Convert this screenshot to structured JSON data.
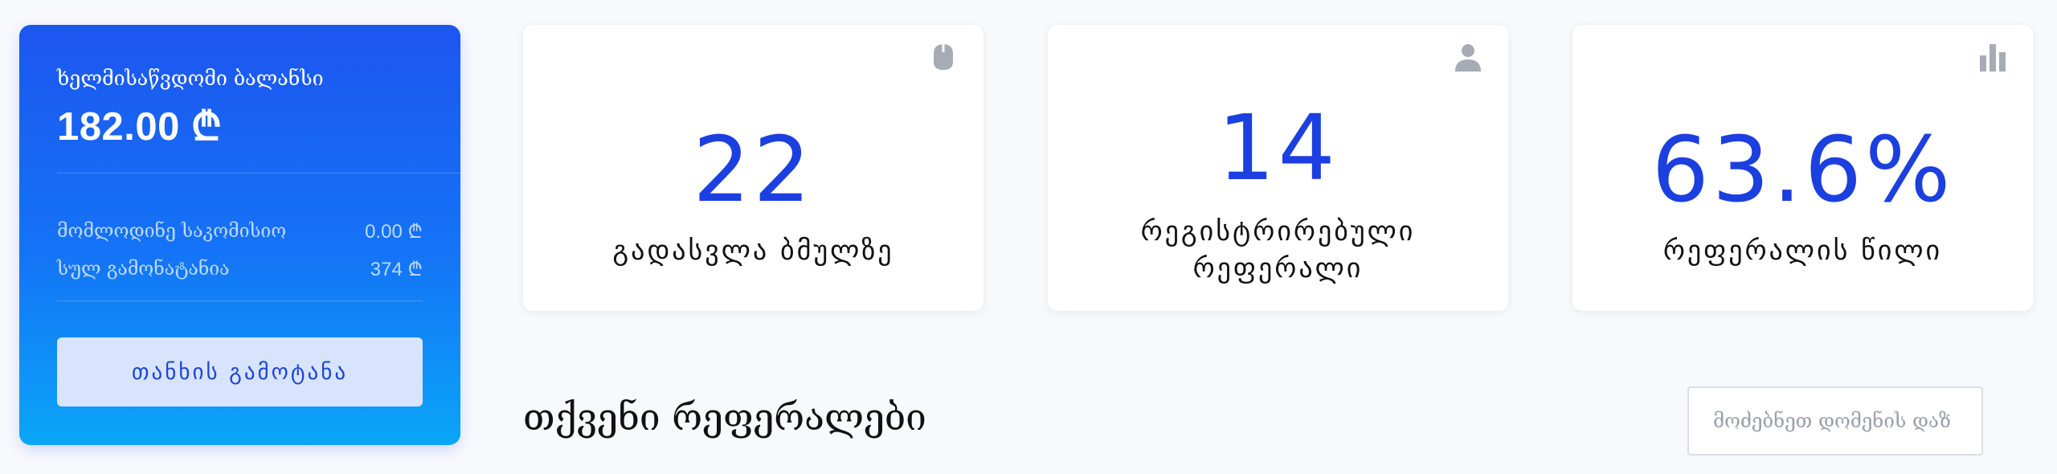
{
  "balance_card": {
    "label": "ხელმისაწვდომი ბალანსი",
    "amount": "182.00 ₾",
    "pending_commission_label": "მომლოდინე საკომისიო",
    "pending_commission_value": "0.00 ₾",
    "total_earned_label": "სულ გამონატანია",
    "total_earned_value": "374 ₾",
    "withdraw_button_label": "თანხის გამოტანა",
    "gradient_colors": [
      "#1d55f0",
      "#0aa6f8"
    ],
    "button_bg": "#d8e4fe"
  },
  "stats": [
    {
      "value": "22",
      "label": "გადასვლა ბმულზე",
      "icon": "mouse-icon"
    },
    {
      "value": "14",
      "label": "რეგისტრირებული რეფერალი",
      "icon": "user-icon"
    },
    {
      "value": "63.6%",
      "label": "რეფერალის წილი",
      "icon": "bar-chart-icon"
    }
  ],
  "referrals_section": {
    "title": "თქვენი რეფერალები",
    "search_placeholder": "მოძებნეთ დომენის დაზ"
  },
  "colors": {
    "accent": "#1c3fe0",
    "icon_gray": "#a7abb5",
    "background": "#f8f9fc"
  }
}
